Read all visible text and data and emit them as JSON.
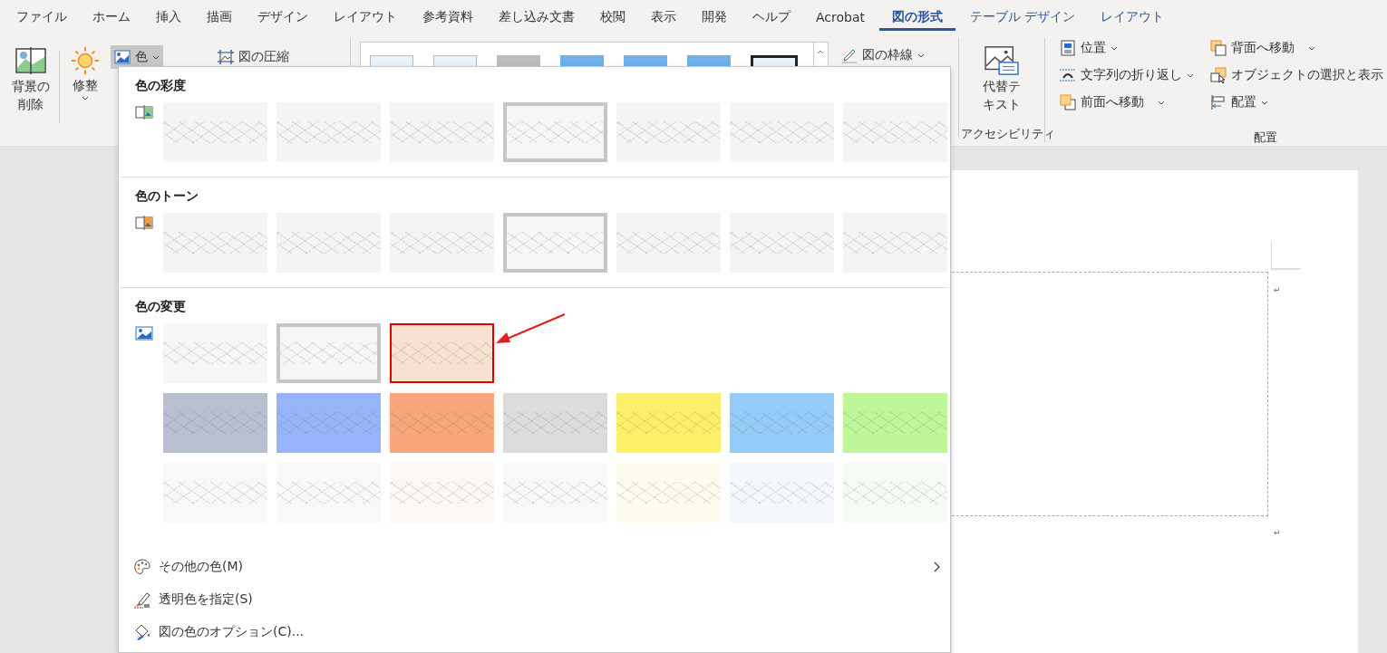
{
  "menu_tabs": [
    {
      "label": "ファイル",
      "selected": false
    },
    {
      "label": "ホーム",
      "selected": false
    },
    {
      "label": "挿入",
      "selected": false
    },
    {
      "label": "描画",
      "selected": false
    },
    {
      "label": "デザイン",
      "selected": false
    },
    {
      "label": "レイアウト",
      "selected": false
    },
    {
      "label": "参考資料",
      "selected": false
    },
    {
      "label": "差し込み文書",
      "selected": false
    },
    {
      "label": "校閲",
      "selected": false
    },
    {
      "label": "表示",
      "selected": false
    },
    {
      "label": "開発",
      "selected": false
    },
    {
      "label": "ヘルプ",
      "selected": false
    },
    {
      "label": "Acrobat",
      "selected": false
    },
    {
      "label": "図の形式",
      "selected": true
    },
    {
      "label": "テーブル デザイン",
      "selected": false,
      "kind": "contextual"
    },
    {
      "label": "レイアウト",
      "selected": false,
      "kind": "contextual"
    }
  ],
  "ribbon": {
    "remove_background": "背景の削除",
    "corrections": "修整",
    "color": {
      "label": "色",
      "pressed": true
    },
    "compress": "図の圧縮",
    "picture_border": "図の枠線",
    "alt_text": "代替テキスト",
    "accessibility_group": "アクセシビリティ",
    "position": "位置",
    "wrap_text": "文字列の折り返し",
    "bring_forward": "前面へ移動",
    "send_backward": "背面へ移動",
    "selection_pane": "オブジェクトの選択と表示",
    "align": "配置",
    "arrange_group": "配置"
  },
  "color_menu": {
    "sections": [
      {
        "title": "色の彩度",
        "rows": [
          [
            {
              "color": "#f4f4f4",
              "selected": false,
              "highlighted": false
            },
            {
              "color": "#f4f4f4",
              "selected": false,
              "highlighted": false
            },
            {
              "color": "#f4f4f4",
              "selected": false,
              "highlighted": false
            },
            {
              "color": "#f6f6f6",
              "selected": true,
              "highlighted": false
            },
            {
              "color": "#f4f4f4",
              "selected": false,
              "highlighted": false
            },
            {
              "color": "#f4f4f4",
              "selected": false,
              "highlighted": false
            },
            {
              "color": "#f4f4f4",
              "selected": false,
              "highlighted": false
            }
          ]
        ]
      },
      {
        "title": "色のトーン",
        "rows": [
          [
            {
              "color": "#f4f4f4",
              "selected": false,
              "highlighted": false
            },
            {
              "color": "#f4f4f4",
              "selected": false,
              "highlighted": false
            },
            {
              "color": "#f4f4f4",
              "selected": false,
              "highlighted": false
            },
            {
              "color": "#f6f6f6",
              "selected": true,
              "highlighted": false
            },
            {
              "color": "#f4f4f4",
              "selected": false,
              "highlighted": false
            },
            {
              "color": "#f4f4f4",
              "selected": false,
              "highlighted": false
            },
            {
              "color": "#f4f4f4",
              "selected": false,
              "highlighted": false
            }
          ]
        ]
      },
      {
        "title": "色の変更",
        "rows": [
          [
            {
              "color": "#f6f6f6",
              "selected": false,
              "highlighted": false
            },
            {
              "color": "#f6f6f6",
              "selected": true,
              "highlighted": false
            },
            {
              "color": "#f6e2cf",
              "selected": false,
              "highlighted": true
            }
          ],
          [
            {
              "color": "#b8bfcf",
              "selected": false,
              "highlighted": false
            },
            {
              "color": "#98b4f8",
              "selected": false,
              "highlighted": false
            },
            {
              "color": "#f7a77b",
              "selected": false,
              "highlighted": false
            },
            {
              "color": "#dcdcdc",
              "selected": false,
              "highlighted": false
            },
            {
              "color": "#fcf06a",
              "selected": false,
              "highlighted": false
            },
            {
              "color": "#93ccf8",
              "selected": false,
              "highlighted": false
            },
            {
              "color": "#bef69a",
              "selected": false,
              "highlighted": false
            }
          ],
          [
            {
              "color": "#f8f8f8",
              "selected": false,
              "highlighted": false
            },
            {
              "color": "#f6f8fa",
              "selected": false,
              "highlighted": false
            },
            {
              "color": "#fbf8f4",
              "selected": false,
              "highlighted": false
            },
            {
              "color": "#f8f8f8",
              "selected": false,
              "highlighted": false
            },
            {
              "color": "#fcfbec",
              "selected": false,
              "highlighted": false
            },
            {
              "color": "#f4f8fc",
              "selected": false,
              "highlighted": false
            },
            {
              "color": "#f6faf4",
              "selected": false,
              "highlighted": false
            }
          ]
        ]
      }
    ],
    "commands": [
      {
        "label": "その他の色(M)",
        "submenu": true
      },
      {
        "label": "透明色を指定(S)",
        "submenu": false
      },
      {
        "label": "図の色のオプション(C)...",
        "submenu": false
      }
    ]
  },
  "document": {
    "paragraph_marks": [
      "↵",
      "↵"
    ]
  }
}
